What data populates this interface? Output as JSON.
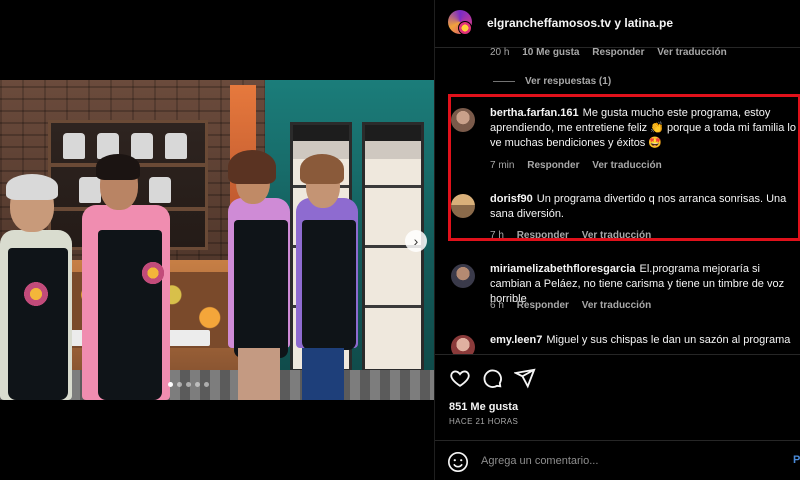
{
  "header": {
    "title": "elgrancheffamosos.tv y latina.pe"
  },
  "prev_comment_meta": {
    "time": "20 h",
    "likes": "10 Me gusta",
    "reply": "Responder",
    "translate": "Ver traducción"
  },
  "view_replies": "Ver respuestas (1)",
  "comments": [
    {
      "username": "bertha.farfan.161",
      "text": "Me gusta mucho este programa, estoy aprendiendo, me entretiene feliz 👏 porque a toda mi familia lo ve muchas bendiciones y éxitos 🤩",
      "time": "7 min",
      "reply": "Responder",
      "translate": "Ver traducción"
    },
    {
      "username": "dorisf90",
      "text": "Un programa divertido q nos arranca sonrisas. Una sana diversión.",
      "time": "7 h",
      "reply": "Responder",
      "translate": "Ver traducción"
    },
    {
      "username": "miriamelizabethfloresgarcia",
      "text": "El.programa mejoraría si cambian a Peláez, no tiene carisma y tiene un timbre de voz horrible",
      "time": "6 h",
      "reply": "Responder",
      "translate": "Ver traducción"
    },
    {
      "username": "emy.leen7",
      "text": "Miguel y sus chispas le dan un sazón al programa",
      "time": "",
      "reply": "",
      "translate": ""
    }
  ],
  "actions": {
    "like_icon": "heart-icon",
    "comment_icon": "comment-icon",
    "share_icon": "share-icon"
  },
  "likes": "851 Me gusta",
  "posted": "HACE 21 HORAS",
  "composer": {
    "placeholder": "Agrega un comentario...",
    "post_label": "P"
  },
  "colors": {
    "highlight": "#e0111b",
    "post_button": "#4a8ad8"
  }
}
